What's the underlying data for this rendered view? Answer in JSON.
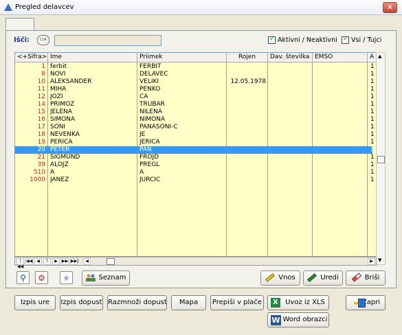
{
  "window": {
    "title": "Pregled delavcev",
    "close_symbol": "✕"
  },
  "search": {
    "label": "Išči:",
    "clr_label": "CLR",
    "value": ""
  },
  "filters": [
    {
      "label": "Aktivni / Neaktivni",
      "checked": true
    },
    {
      "label": "Vsi / Tujci",
      "checked": true
    }
  ],
  "table": {
    "headers": [
      "<+Sifra>",
      "Ime",
      "Priimek",
      "Rojen",
      "Dav. številka",
      "EMSO",
      "A"
    ],
    "selected_index": 11,
    "rows": [
      {
        "code": "1",
        "name": "ferbit",
        "surname": "FERBIT",
        "born": "",
        "tax": "",
        "emso": "",
        "a": "1"
      },
      {
        "code": "8",
        "name": "NOVI",
        "surname": "DELAVEC",
        "born": "",
        "tax": "",
        "emso": "",
        "a": "1"
      },
      {
        "code": "10",
        "name": "ALEKSANDER",
        "surname": "VELIKI",
        "born": "12.05.1978",
        "tax": "",
        "emso": "",
        "a": "1"
      },
      {
        "code": "11",
        "name": "MIHA",
        "surname": "PENKO",
        "born": "",
        "tax": "",
        "emso": "",
        "a": "1"
      },
      {
        "code": "12",
        "name": "JOZI",
        "surname": "CA",
        "born": "",
        "tax": "",
        "emso": "",
        "a": "1"
      },
      {
        "code": "14",
        "name": "PRIMOZ",
        "surname": "TRUBAR",
        "born": "",
        "tax": "",
        "emso": "",
        "a": "1"
      },
      {
        "code": "15",
        "name": "JELENA",
        "surname": "NILENA",
        "born": "",
        "tax": "",
        "emso": "",
        "a": "1"
      },
      {
        "code": "16",
        "name": "SIMONA",
        "surname": "NIMONA",
        "born": "",
        "tax": "",
        "emso": "",
        "a": "1"
      },
      {
        "code": "17",
        "name": "SONI",
        "surname": "PANASONI-C",
        "born": "",
        "tax": "",
        "emso": "",
        "a": "1"
      },
      {
        "code": "18",
        "name": "NEVENKA",
        "surname": "JE",
        "born": "",
        "tax": "",
        "emso": "",
        "a": "1"
      },
      {
        "code": "19",
        "name": "PERICA",
        "surname": "JERICA",
        "born": "",
        "tax": "",
        "emso": "",
        "a": "1"
      },
      {
        "code": "20",
        "name": "PETER",
        "surname": "PAN",
        "born": "",
        "tax": "",
        "emso": "",
        "a": "1"
      },
      {
        "code": "21",
        "name": "SIGMUND",
        "surname": "FROJD",
        "born": "",
        "tax": "",
        "emso": "",
        "a": "1"
      },
      {
        "code": "39",
        "name": "ALOJZ",
        "surname": "PREGL",
        "born": "",
        "tax": "",
        "emso": "",
        "a": "1"
      },
      {
        "code": "510",
        "name": "A",
        "surname": "A",
        "born": "",
        "tax": "",
        "emso": "",
        "a": "1"
      },
      {
        "code": "1000",
        "name": "JANEZ",
        "surname": "JURCIC",
        "born": "",
        "tax": "",
        "emso": "",
        "a": "1"
      }
    ]
  },
  "navigator": [
    "|◀◀",
    "◀◀",
    "◀",
    "?",
    "▶",
    "▶▶",
    "▶▶|"
  ],
  "scroll_arrows": {
    "up": "▲",
    "down": "▼",
    "left": "◀",
    "right": "▶"
  },
  "tools": {
    "seznam": "Seznam",
    "vnos": "Vnos",
    "uredi": "Uredi",
    "brisi": "Briši",
    "search_icon": "search-icon",
    "zoom_icon": "zoom-icon",
    "star_icon": "star-icon"
  },
  "actions": {
    "izpis_ure": "Izpis ure",
    "izpis_dopust": "Izpis dopust",
    "razmnozi_dopust": "Razmnoži dopust",
    "mapa": "Mapa",
    "prepisi": "Prepiši v plače",
    "uvoz_xls": "Uvoz iz XLS",
    "word": "Word obrazci",
    "zapri": "Zapri",
    "xls_letter": "X",
    "word_letter": "W"
  }
}
